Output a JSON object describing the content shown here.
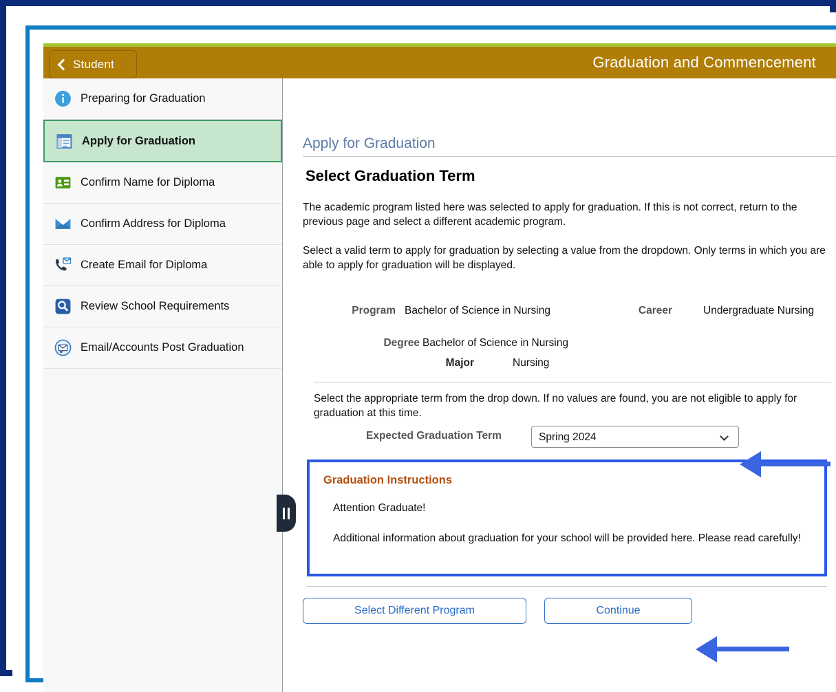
{
  "header": {
    "back_label": "Student",
    "title": "Graduation and Commencement"
  },
  "sidebar": {
    "items": [
      {
        "label": "Preparing for Graduation",
        "icon": "info-circle-icon",
        "active": false
      },
      {
        "label": "Apply for Graduation",
        "icon": "form-window-icon",
        "active": true
      },
      {
        "label": "Confirm Name for Diploma",
        "icon": "id-card-icon",
        "active": false
      },
      {
        "label": "Confirm Address for Diploma",
        "icon": "envelope-icon",
        "active": false
      },
      {
        "label": "Create Email for Diploma",
        "icon": "phone-envelope-icon",
        "active": false
      },
      {
        "label": "Review School Requirements",
        "icon": "magnifier-icon",
        "active": false
      },
      {
        "label": "Email/Accounts Post Graduation",
        "icon": "email-circle-icon",
        "active": false
      }
    ]
  },
  "main": {
    "breadcrumb": "Apply for Graduation",
    "section_title": "Select Graduation Term",
    "paragraph_1": "The academic program listed here was selected to apply for graduation. If this is not correct, return to the previous page and select a different academic program.",
    "paragraph_2": "Select a valid term to apply for graduation by selecting a value from the dropdown. Only terms in which you are able to apply for graduation will be displayed.",
    "details": {
      "program_label": "Program",
      "program_value": "Bachelor of Science in Nursing",
      "career_label": "Career",
      "career_value": "Undergraduate Nursing",
      "degree_label": "Degree",
      "degree_value": "Bachelor of Science in Nursing",
      "major_label": "Major",
      "major_value": "Nursing"
    },
    "term": {
      "note": "Select the appropriate term from the drop down. If no values are found, you are not eligible to apply for graduation at this time.",
      "label": "Expected Graduation Term",
      "selected": "Spring 2024",
      "options": [
        "Spring 2024"
      ]
    },
    "instructions": {
      "title": "Graduation Instructions",
      "line_1": "Attention Graduate!",
      "line_2": "Additional information about graduation for your school will be provided here. Please read carefully!"
    },
    "buttons": {
      "select_different_program": "Select Different Program",
      "continue": "Continue"
    }
  },
  "colors": {
    "header_gold": "#b07d07",
    "header_top_green": "#a5c62b",
    "active_nav_green": "#c6e6ce",
    "active_nav_border": "#3e9b63",
    "annotation_blue": "#2a58e8",
    "arrow_blue": "#3a65e0",
    "link_blue": "#2a6bc4",
    "breadcrumb_blue": "#5b7ba6",
    "instructions_title_orange": "#b4500e",
    "frame_navy": "#0b2b7a",
    "frame_cyan": "#0f7dc2"
  }
}
